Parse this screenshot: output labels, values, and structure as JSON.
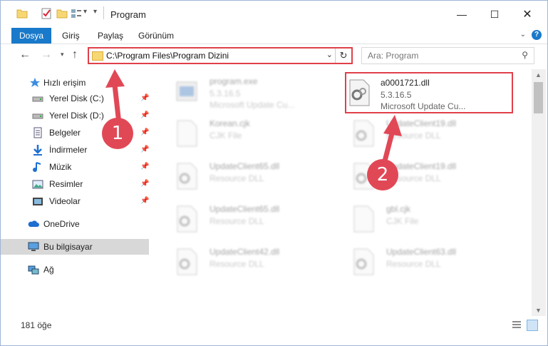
{
  "window": {
    "title": "Program"
  },
  "ribbon": {
    "tabs": [
      {
        "label": "Dosya",
        "active": true
      },
      {
        "label": "Giriş"
      },
      {
        "label": "Paylaş"
      },
      {
        "label": "Görünüm"
      }
    ]
  },
  "address": {
    "path": "C:\\Program Files\\Program Dizini"
  },
  "search": {
    "placeholder": "Ara: Program"
  },
  "sidebar": {
    "items": [
      {
        "label": "Hızlı erişim",
        "icon": "star-icon"
      },
      {
        "label": "Yerel Disk (C:)",
        "icon": "drive-icon",
        "pinned": true
      },
      {
        "label": "Yerel Disk (D:)",
        "icon": "drive-icon",
        "pinned": true
      },
      {
        "label": "Belgeler",
        "icon": "documents-icon",
        "pinned": true
      },
      {
        "label": "İndirmeler",
        "icon": "download-icon",
        "pinned": true
      },
      {
        "label": "Müzik",
        "icon": "music-icon",
        "pinned": true
      },
      {
        "label": "Resimler",
        "icon": "pictures-icon",
        "pinned": true
      },
      {
        "label": "Videolar",
        "icon": "videos-icon",
        "pinned": true
      },
      {
        "label": "OneDrive",
        "icon": "cloud-icon"
      },
      {
        "label": "Bu bilgisayar",
        "icon": "computer-icon",
        "selected": true
      },
      {
        "label": "Ağ",
        "icon": "network-icon"
      }
    ]
  },
  "files": [
    {
      "name": "program.exe",
      "d1": "5.3.16.5",
      "d2": "Microsoft Update Cu...",
      "blurred": true
    },
    {
      "name": "a0001721.dll",
      "d1": "5.3.16.5",
      "d2": "Microsoft Update Cu...",
      "blurred": false
    },
    {
      "name": "Korean.cjk",
      "d1": "CJK File",
      "d2": "",
      "blurred": true
    },
    {
      "name": "UpdateClient19.dll",
      "d1": "Resource DLL",
      "d2": "",
      "blurred": true
    },
    {
      "name": "UpdateClient65.dll",
      "d1": "Resource DLL",
      "d2": "",
      "blurred": true
    },
    {
      "name": "UpdateClient19.dll",
      "d1": "Resource DLL",
      "d2": "",
      "blurred": true
    },
    {
      "name": "UpdateClient65.dll",
      "d1": "Resource DLL",
      "d2": "",
      "blurred": true
    },
    {
      "name": "gbl.cjk",
      "d1": "CJK File",
      "d2": "",
      "blurred": true
    },
    {
      "name": "UpdateClient42.dll",
      "d1": "Resource DLL",
      "d2": "",
      "blurred": true
    },
    {
      "name": "UpdateClient63.dll",
      "d1": "Resource DLL",
      "d2": "",
      "blurred": true
    }
  ],
  "status": {
    "count": "181 öğe"
  },
  "callouts": {
    "one": "1",
    "two": "2"
  },
  "colors": {
    "accent": "#1979ca",
    "callout": "#e14856"
  }
}
